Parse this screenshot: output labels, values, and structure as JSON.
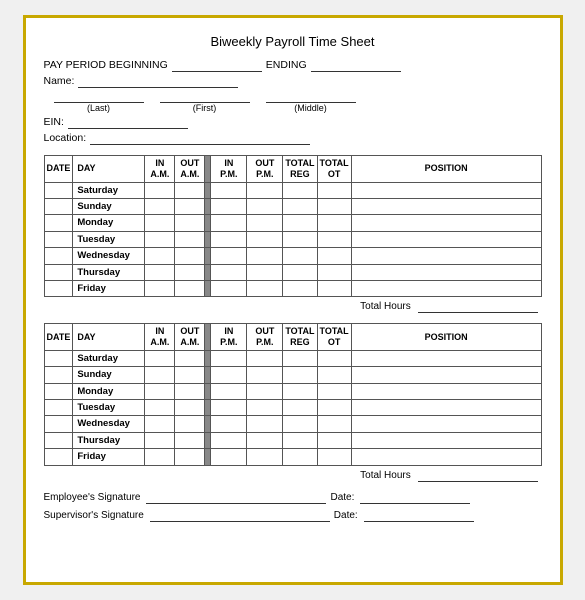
{
  "title": "Biweekly Payroll Time Sheet",
  "header": {
    "pay_period_beginning_label": "PAY PERIOD BEGINNING",
    "ending_label": "ENDING",
    "name_label": "Name:",
    "name_last": "(Last)",
    "name_first": "(First)",
    "name_middle": "(Middle)",
    "ein_label": "EIN:",
    "location_label": "Location:"
  },
  "table": {
    "columns": [
      {
        "id": "date",
        "label": "DATE"
      },
      {
        "id": "day",
        "label": "DAY"
      },
      {
        "id": "in_am",
        "label": "IN\nA.M."
      },
      {
        "id": "out_am",
        "label": "OUT\nA.M."
      },
      {
        "id": "in_pm",
        "label": "IN\nP.M."
      },
      {
        "id": "out_pm",
        "label": "OUT\nP.M."
      },
      {
        "id": "total_reg",
        "label": "TOTAL\nREG"
      },
      {
        "id": "total_ot",
        "label": "TOTAL\nOT"
      },
      {
        "id": "position",
        "label": "POSITION"
      }
    ],
    "days": [
      "Saturday",
      "Sunday",
      "Monday",
      "Tuesday",
      "Wednesday",
      "Thursday",
      "Friday"
    ],
    "total_hours_label": "Total Hours"
  },
  "signature": {
    "employee_label": "Employee's Signature",
    "supervisor_label": "Supervisor's Signature",
    "date_label": "Date:"
  }
}
